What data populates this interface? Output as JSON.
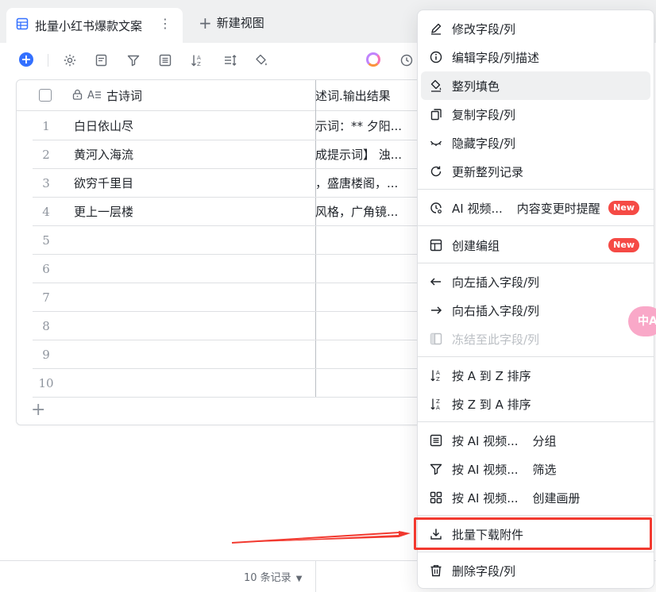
{
  "tabs": {
    "active_label": "批量小红书爆款文案",
    "new_view_label": "新建视图"
  },
  "grid": {
    "column1_header": "古诗词",
    "column2_header": "述词.输出结果",
    "rows": [
      {
        "num": "1",
        "c1": "白日依山尽",
        "c2": "示词：** 夕阳..."
      },
      {
        "num": "2",
        "c1": "黄河入海流",
        "c2": "成提示词】 浊..."
      },
      {
        "num": "3",
        "c1": "欲穷千里目",
        "c2": "，盛唐楼阁，..."
      },
      {
        "num": "4",
        "c1": "更上一层楼",
        "c2": "风格，广角镜..."
      },
      {
        "num": "5",
        "c1": "",
        "c2": ""
      },
      {
        "num": "6",
        "c1": "",
        "c2": ""
      },
      {
        "num": "7",
        "c1": "",
        "c2": ""
      },
      {
        "num": "8",
        "c1": "",
        "c2": ""
      },
      {
        "num": "9",
        "c1": "",
        "c2": ""
      },
      {
        "num": "10",
        "c1": "",
        "c2": ""
      }
    ]
  },
  "footer": {
    "record_count": "10 条记录"
  },
  "menu": {
    "edit_field": "修改字段/列",
    "edit_desc": "编辑字段/列描述",
    "fill_color": "整列填色",
    "copy_field": "复制字段/列",
    "hide_field": "隐藏字段/列",
    "refresh_records": "更新整列记录",
    "ai_video": "AI 视频...",
    "change_alert": "内容变更时提醒",
    "new_badge": "New",
    "create_group": "创建编组",
    "insert_left": "向左插入字段/列",
    "insert_right": "向右插入字段/列",
    "freeze": "冻结至此字段/列",
    "sort_az": "按 A 到 Z 排序",
    "sort_za": "按 Z 到 A 排序",
    "group_by": "按 AI 视频...",
    "group_label": "分组",
    "filter_by": "按 AI 视频...",
    "filter_label": "筛选",
    "gallery_by": "按 AI 视频...",
    "gallery_label": "创建画册",
    "batch_download": "批量下载附件",
    "delete_field": "删除字段/列"
  },
  "float_bubble": "中A",
  "colors": {
    "accent": "#3370ff",
    "highlight_red": "#f2392f",
    "badge_red": "#f54a45"
  }
}
